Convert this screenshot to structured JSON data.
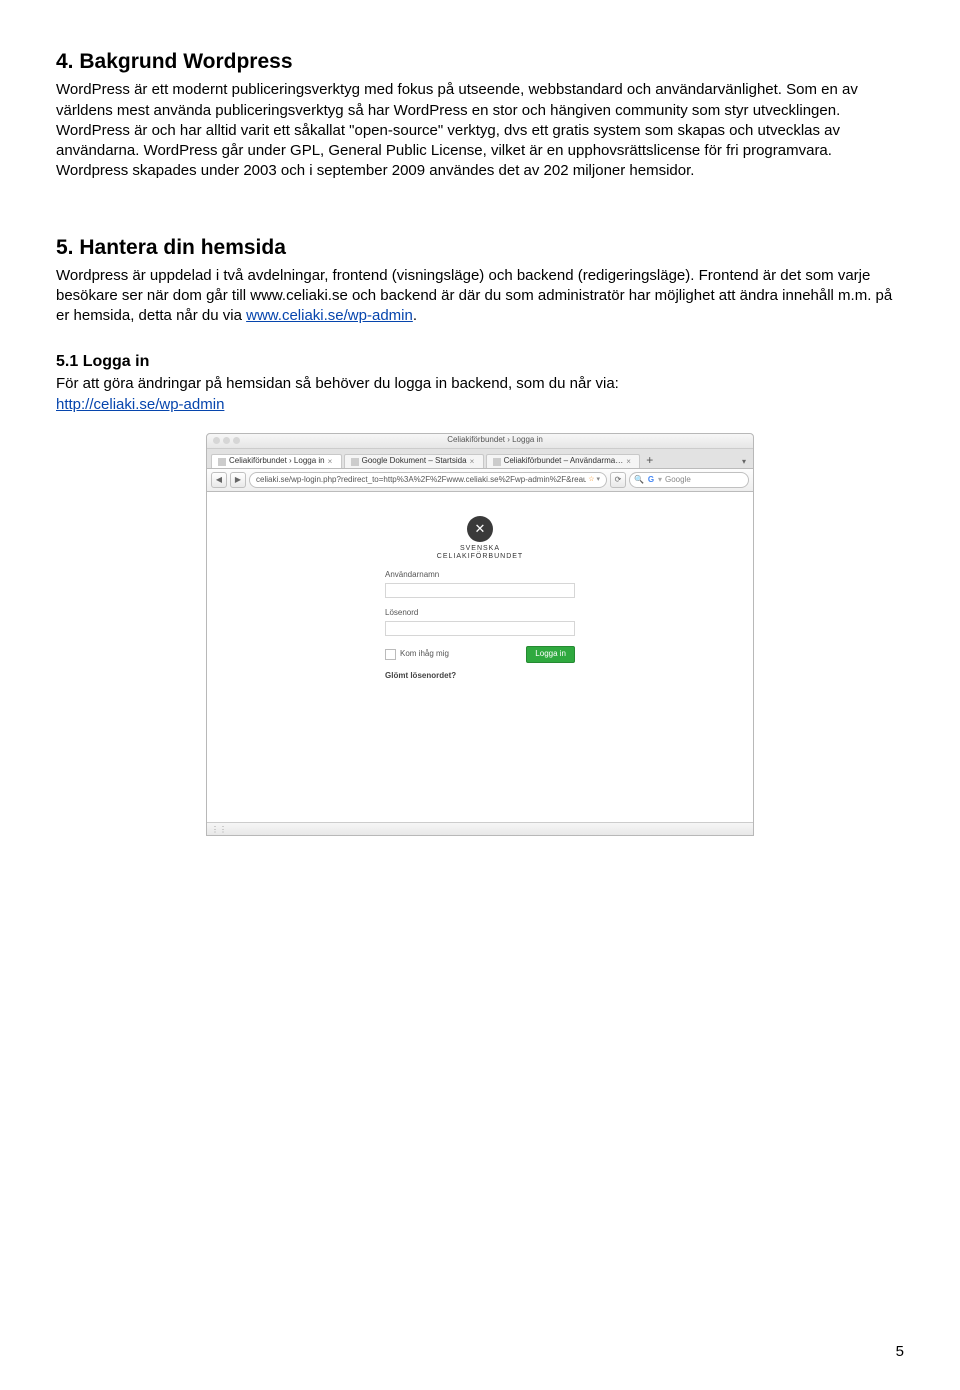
{
  "section4": {
    "heading": "4. Bakgrund Wordpress",
    "body": "WordPress är ett modernt publiceringsverktyg med fokus på utseende, webbstandard och användarvänlighet. Som en av världens mest använda publiceringsverktyg så har WordPress en stor och hängiven community som styr utvecklingen. WordPress är och har alltid varit ett såkallat \"open-source\" verktyg, dvs ett gratis system som skapas och utvecklas av användarna. WordPress går under GPL, General Public License, vilket är en upphovsrättslicense för fri programvara. Wordpress skapades under 2003 och i september 2009 användes det av 202 miljoner hemsidor."
  },
  "section5": {
    "heading": "5. Hantera din hemsida",
    "body_start": "Wordpress är uppdelad i två avdelningar, frontend (visningsläge) och backend (redigeringsläge). Frontend är det som varje besökare ser när dom går till www.celiaki.se och backend är där du som administratör har möjlighet att ändra innehåll m.m. på er hemsida, detta når du via ",
    "body_link": "www.celiaki.se/wp-admin",
    "body_end": "."
  },
  "section51": {
    "heading": "5.1 Logga in",
    "body": "För att göra ändringar på hemsidan så behöver du logga in backend, som du når via:",
    "link": "http://celiaki.se/wp-admin"
  },
  "screenshot": {
    "window_title": "Celiakiförbundet › Logga in",
    "tabs": [
      "Celiakiförbundet › Logga in",
      "Google Dokument – Startsida",
      "Celiakiförbundet – Användarma…"
    ],
    "tab_plus": "+",
    "url": "celiaki.se/wp-login.php?redirect_to=http%3A%2F%2Fwww.celiaki.se%2Fwp-admin%2F&reau",
    "search_placeholder": "Google",
    "logo_line1": "SVENSKA",
    "logo_line2": "CELIAKIFÖRBUNDET",
    "label_user": "Användarnamn",
    "label_pass": "Lösenord",
    "remember": "Kom ihåg mig",
    "login_button": "Logga in",
    "forgot": "Glömt lösenordet?"
  },
  "page_number": "5"
}
